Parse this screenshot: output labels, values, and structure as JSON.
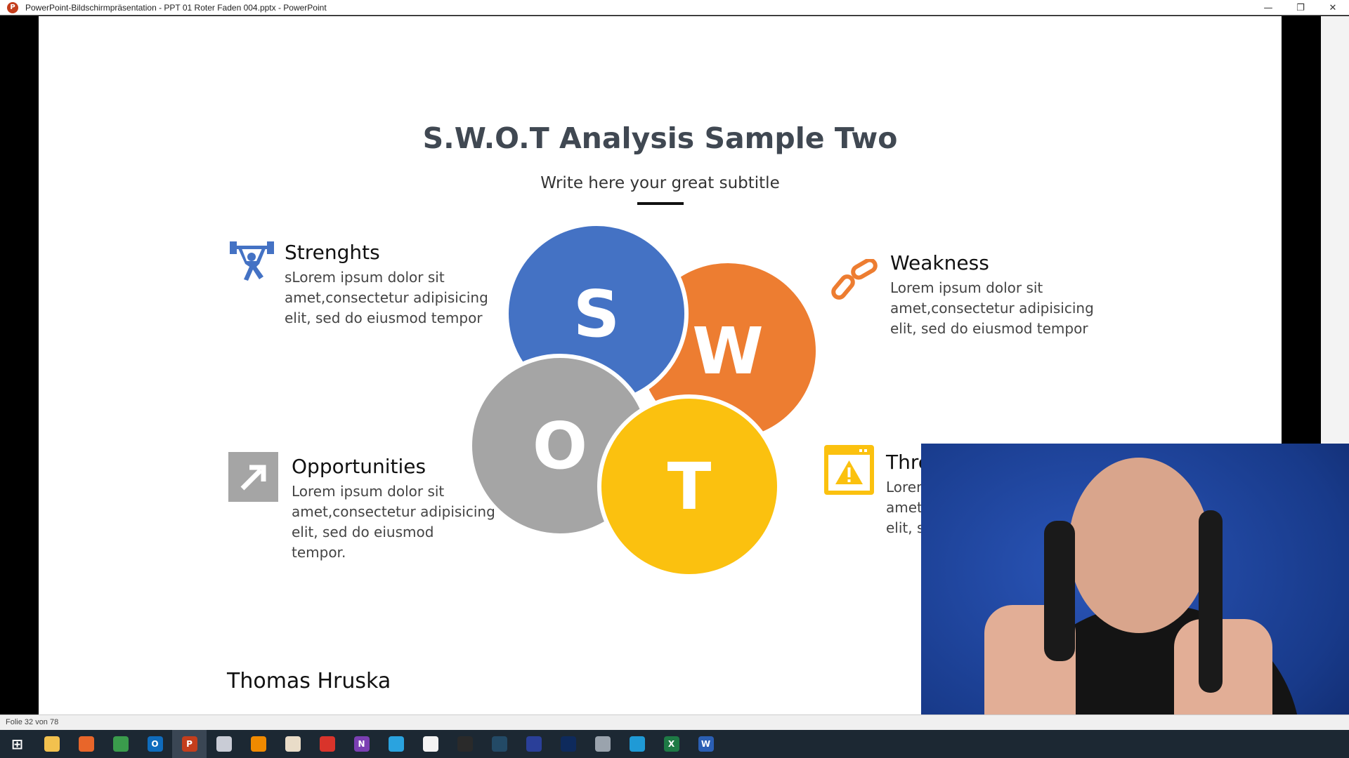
{
  "window": {
    "title": "PowerPoint-Bildschirmpräsentation  -  PPT 01 Roter Faden 004.pptx - PowerPoint",
    "app_icon": "P"
  },
  "slide": {
    "title": "S.W.O.T Analysis Sample Two",
    "subtitle": "Write here your great subtitle",
    "circles": [
      {
        "letter": "S",
        "color": "#4472c4"
      },
      {
        "letter": "W",
        "color": "#ed7d31"
      },
      {
        "letter": "O",
        "color": "#a5a5a5"
      },
      {
        "letter": "T",
        "color": "#fbc10f"
      }
    ],
    "strengths": {
      "heading": "Strenghts",
      "lines": [
        "sLorem ipsum dolor sit",
        "amet,consectetur adipisicing",
        "elit, sed do eiusmod tempor"
      ],
      "icon": "weightlifter-icon",
      "color": "#4472c4"
    },
    "weakness": {
      "heading": "Weakness",
      "lines": [
        "Lorem ipsum dolor sit",
        "amet,consectetur adipisicing",
        "elit, sed do eiusmod tempor"
      ],
      "icon": "broken-chain-icon",
      "color": "#ed7d31"
    },
    "opportunities": {
      "heading": "Opportunities",
      "lines": [
        "Lorem ipsum dolor sit",
        "amet,consectetur adipisicing",
        "elit, sed do eiusmod",
        "tempor."
      ],
      "icon": "arrow-up-right-icon",
      "color": "#a5a5a5"
    },
    "threats": {
      "heading": "Thre",
      "lines": [
        "Lorem",
        "amet,",
        "elit, se"
      ],
      "icon": "warning-window-icon",
      "color": "#fbc10f"
    },
    "author": "Thomas Hruska"
  },
  "status": {
    "slide_counter": "Folie 32 von 78"
  },
  "taskbar": [
    {
      "name": "start",
      "glyph": "⊞",
      "color": "#1c2833"
    },
    {
      "name": "file-explorer",
      "glyph": "",
      "color": "#f2c14e"
    },
    {
      "name": "firefox",
      "glyph": "",
      "color": "#e8662a"
    },
    {
      "name": "chrome",
      "glyph": "",
      "color": "#3a9c4c"
    },
    {
      "name": "outlook",
      "glyph": "O",
      "color": "#0f6cbd"
    },
    {
      "name": "powerpoint",
      "glyph": "P",
      "color": "#c43e1c"
    },
    {
      "name": "app-paint",
      "glyph": "",
      "color": "#c9ccd6"
    },
    {
      "name": "vlc",
      "glyph": "",
      "color": "#f08a00"
    },
    {
      "name": "app-doc",
      "glyph": "",
      "color": "#e9dcc8"
    },
    {
      "name": "app-lips",
      "glyph": "",
      "color": "#d9342b"
    },
    {
      "name": "onenote",
      "glyph": "N",
      "color": "#7b3fb3"
    },
    {
      "name": "telegram",
      "glyph": "",
      "color": "#2aa3df"
    },
    {
      "name": "app-red",
      "glyph": "",
      "color": "#f4f4f4"
    },
    {
      "name": "obs",
      "glyph": "",
      "color": "#2a2a2a"
    },
    {
      "name": "app-circle",
      "glyph": "",
      "color": "#234a66"
    },
    {
      "name": "app-blue",
      "glyph": "",
      "color": "#2a3f99"
    },
    {
      "name": "app-video",
      "glyph": "",
      "color": "#0e2a5c"
    },
    {
      "name": "app-scanner",
      "glyph": "",
      "color": "#9aa3ad"
    },
    {
      "name": "edge",
      "glyph": "",
      "color": "#1f9ad6"
    },
    {
      "name": "excel",
      "glyph": "X",
      "color": "#1e7a45"
    },
    {
      "name": "word",
      "glyph": "W",
      "color": "#2b5fb4"
    }
  ]
}
